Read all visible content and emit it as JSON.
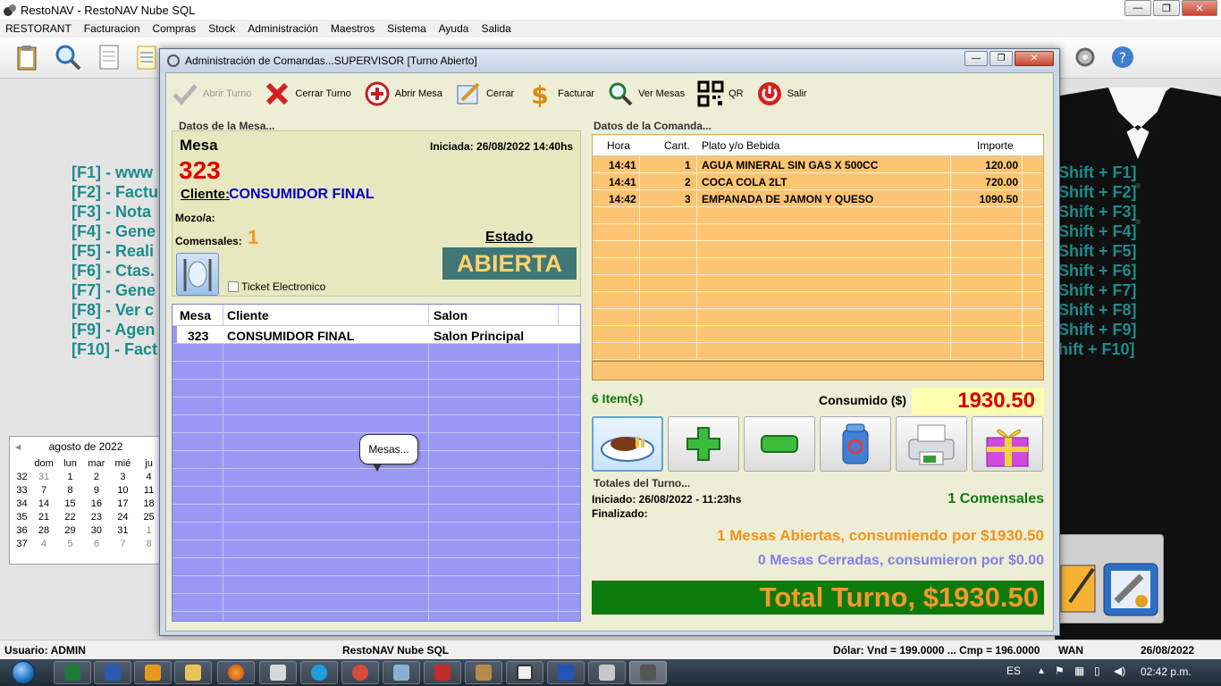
{
  "app": {
    "title": "RestoNAV - RestoNAV Nube SQL",
    "menu": [
      "RESTORANT",
      "Facturacion",
      "Compras",
      "Stock",
      "Administración",
      "Maestros",
      "Sistema",
      "Ayuda",
      "Salida"
    ],
    "window_controls": {
      "minimize": "—",
      "maximize": "❐",
      "close": "✕"
    }
  },
  "desktop": {
    "shortcuts_left": [
      "[F1] - www",
      "[F2] - Factu",
      "[F3] - Nota",
      "[F4] - Gene",
      "[F5] - Reali",
      "[F6] - Ctas.",
      "[F7] - Gene",
      "[F8] - Ver c",
      "[F9] - Agen",
      "[F10] - Fact"
    ],
    "shortcuts_right": [
      "Shift + F1]",
      "Shift + F2]",
      "Shift + F3]",
      "Shift + F4]",
      "Shift + F5]",
      "Shift + F6]",
      "Shift + F7]",
      "Shift + F8]",
      "Shift + F9]",
      "hift + F10]"
    ],
    "calendar": {
      "month": "agosto de 2022",
      "weekdays": [
        "dom",
        "lun",
        "mar",
        "mié",
        "ju"
      ],
      "rows": [
        [
          "32",
          "31",
          "1",
          "2",
          "3",
          "4"
        ],
        [
          "33",
          "7",
          "8",
          "9",
          "10",
          "11"
        ],
        [
          "34",
          "14",
          "15",
          "16",
          "17",
          "18"
        ],
        [
          "35",
          "21",
          "22",
          "23",
          "24",
          "25"
        ],
        [
          "36",
          "28",
          "29",
          "30",
          "31",
          "1"
        ],
        [
          "37",
          "4",
          "5",
          "6",
          "7",
          "8"
        ]
      ]
    }
  },
  "dialog": {
    "title": "Administración de Comandas...SUPERVISOR [Turno Abierto]",
    "actions": [
      {
        "label": "Abrir Turno",
        "icon": "check-icon",
        "enabled": false
      },
      {
        "label": "Cerrar Turno",
        "icon": "red-x-icon",
        "enabled": true
      },
      {
        "label": "Abrir Mesa",
        "icon": "plus-circle-icon",
        "enabled": true
      },
      {
        "label": "Cerrar",
        "icon": "edit-pen-icon",
        "enabled": true
      },
      {
        "label": "Facturar",
        "icon": "dollar-icon",
        "enabled": true
      },
      {
        "label": "Ver Mesas",
        "icon": "magnifier-icon",
        "enabled": true
      },
      {
        "label": "QR",
        "icon": "qr-code-icon",
        "enabled": true
      },
      {
        "label": "Salir",
        "icon": "power-icon",
        "enabled": true
      }
    ],
    "mesa_section": {
      "heading": "Datos de la Mesa...",
      "mesa_label": "Mesa",
      "mesa_number": "323",
      "iniciada": "Iniciada: 26/08/2022 14:40hs",
      "cliente_label": "Cliente:",
      "cliente_value": "CONSUMIDOR FINAL",
      "mozo_label": "Mozo/a:",
      "comensales_label": "Comensales:",
      "comensales_value": "1",
      "estado_label": "Estado",
      "estado_value": "ABIERTA",
      "ticket_label": "Ticket Electronico",
      "ticket_checked": false
    },
    "mesas_table": {
      "headers": [
        "Mesa",
        "Cliente",
        "Salon"
      ],
      "rows": [
        {
          "mesa": "323",
          "cliente": "CONSUMIDOR FINAL",
          "salon": "Salon Principal"
        }
      ],
      "tooltip": "Mesas..."
    },
    "comanda_section": {
      "heading": "Datos de la Comanda...",
      "headers": [
        "Hora",
        "Cant.",
        "Plato y/o Bebida",
        "Importe"
      ],
      "rows": [
        {
          "hora": "14:41",
          "cant": "1",
          "plato": "AGUA MINERAL SIN GAS X 500CC",
          "importe": "120.00"
        },
        {
          "hora": "14:41",
          "cant": "2",
          "plato": "COCA COLA  2LT",
          "importe": "720.00"
        },
        {
          "hora": "14:42",
          "cant": "3",
          "plato": "EMPANADA DE JAMON Y QUESO",
          "importe": "1090.50"
        }
      ],
      "items_count": "6 Item(s)",
      "consumido_label": "Consumido ($)",
      "consumido_value": "1930.50",
      "buttons": [
        "food-plate-icon",
        "green-plus-icon",
        "green-minus-icon",
        "recycle-bin-icon",
        "printer-icon",
        "gift-box-icon"
      ]
    },
    "totales": {
      "heading": "Totales del Turno...",
      "iniciado": "Iniciado: 26/08/2022 - 11:23hs",
      "finalizado": "Finalizado:",
      "comensales": "1 Comensales",
      "abiertas": "1 Mesas Abiertas, consumiendo por $1930.50",
      "cerradas": "0 Mesas Cerradas, consumieron por $0.00",
      "total": "Total Turno, $1930.50"
    }
  },
  "statusbar": {
    "usuario": "Usuario: ADMIN",
    "app": "RestoNAV Nube SQL",
    "dolar": "Dólar: Vnd = 199.0000 ... Cmp = 196.0000",
    "conn": "WAN",
    "date": "26/08/2022"
  },
  "taskbar": {
    "lang": "ES",
    "time": "02:42 p.m."
  },
  "colors": {
    "mesa_panel_bg": "#e8e8c0",
    "mesas_grid_bg": "#9a98f5",
    "comanda_grid_bg": "#fcc472",
    "estado_bg": "#3f7777",
    "estado_fg": "#ffd36b",
    "mesa_number": "#e00000",
    "cliente_value": "#0000cc",
    "total_bar_bg": "#0d7a0d",
    "total_text": "#f39a2a",
    "cerradas_text": "#7f7fe8",
    "shortcut_text": "#1d8c8c"
  }
}
